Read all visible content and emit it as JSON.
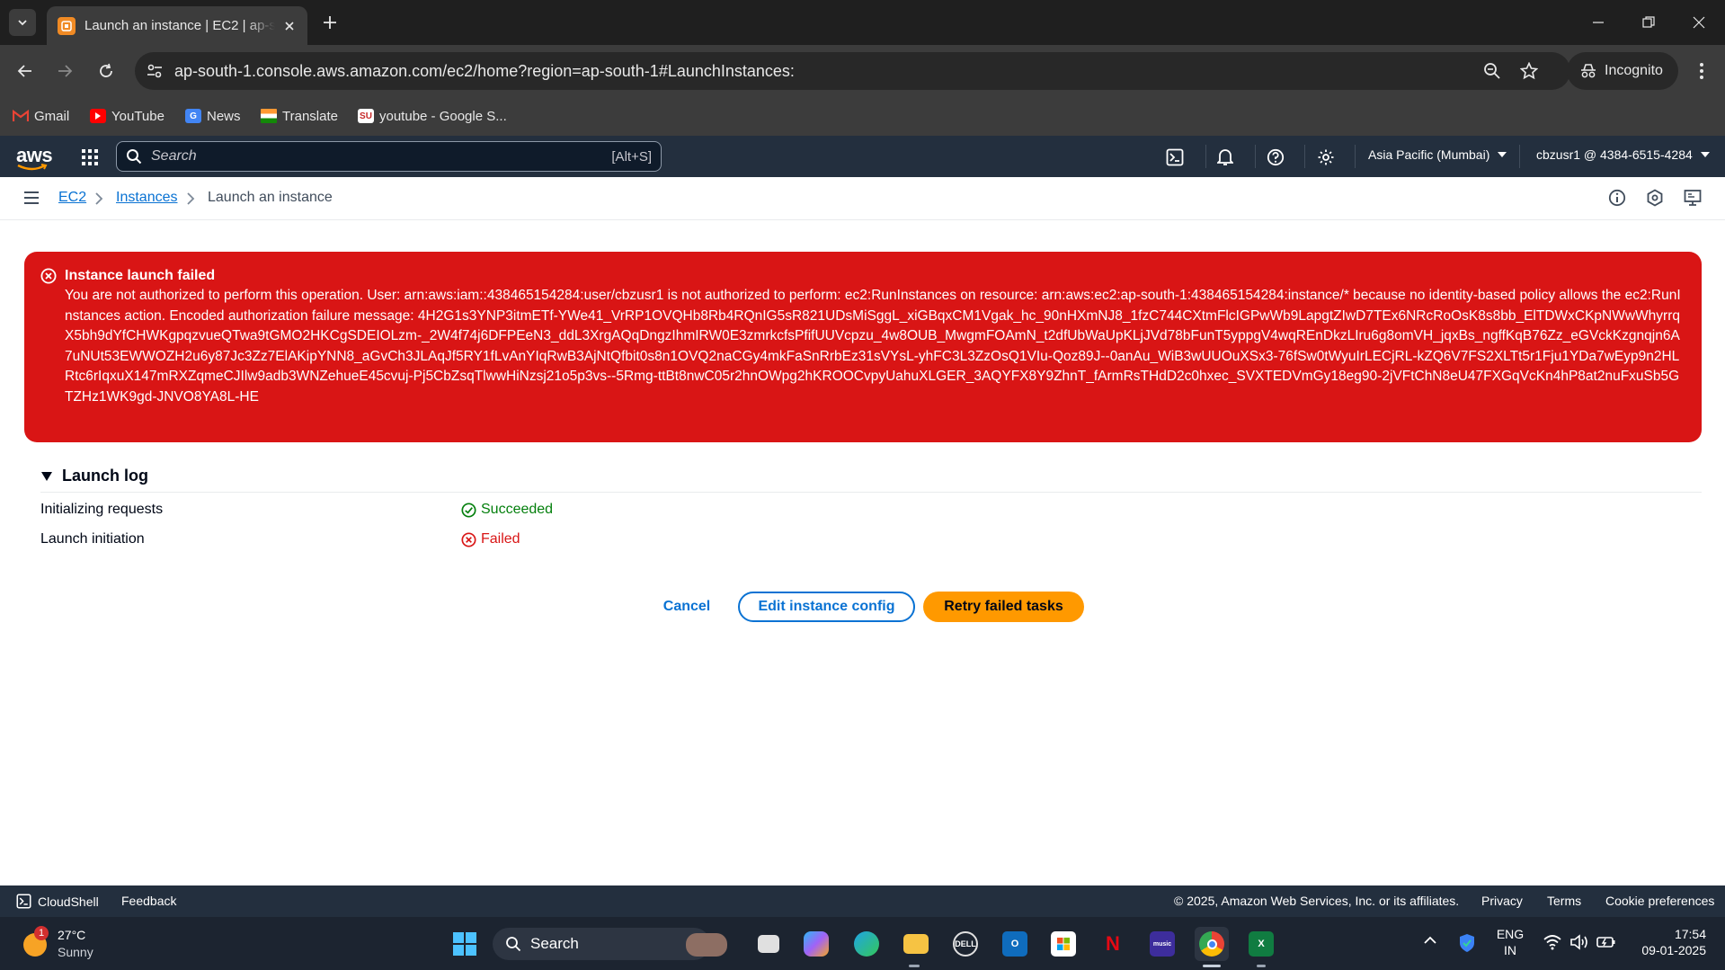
{
  "browser": {
    "tab_title": "Launch an instance | EC2 | ap-south-1",
    "url": "ap-south-1.console.aws.amazon.com/ec2/home?region=ap-south-1#LaunchInstances:",
    "incognito_label": "Incognito",
    "bookmarks": [
      {
        "label": "Gmail",
        "color": "#ea4335",
        "icon": "gmail-icon"
      },
      {
        "label": "YouTube",
        "color": "#ff0000",
        "icon": "youtube-icon"
      },
      {
        "label": "News",
        "color": "#4285f4",
        "icon": "news-icon"
      },
      {
        "label": "Translate",
        "color": "#ff9933",
        "icon": "translate-icon"
      },
      {
        "label": "youtube - Google S...",
        "color": "#6a1b9a",
        "icon": "sheets-icon"
      }
    ]
  },
  "aws_nav": {
    "logo": "aws",
    "search_placeholder": "Search",
    "search_shortcut": "[Alt+S]",
    "region": "Asia Pacific (Mumbai)",
    "account": "cbzusr1 @ 4384-6515-4284"
  },
  "breadcrumb": {
    "items": [
      "EC2",
      "Instances",
      "Launch an instance"
    ]
  },
  "flash": {
    "title": "Instance launch failed",
    "message": "You are not authorized to perform this operation. User: arn:aws:iam::438465154284:user/cbzusr1 is not authorized to perform: ec2:RunInstances on resource: arn:aws:ec2:ap-south-1:438465154284:instance/* because no identity-based policy allows the ec2:RunInstances action. Encoded authorization failure message: 4H2G1s3YNP3itmETf-YWe41_VrRP1OVQHb8Rb4RQnIG5sR821UDsMiSggL_xiGBqxCM1Vgak_hc_90nHXmNJ8_1fzC744CXtmFlcIGPwWb9LapgtZIwD7TEx6NRcRoOsK8s8bb_ElTDWxCKpNWwWhyrrqX5bh9dYfCHWKgpqzvueQTwa9tGMO2HKCgSDEIOLzm-_2W4f74j6DFPEeN3_ddL3XrgAQqDngzIhmIRW0E3zmrkcfsPfifUUVcpzu_4w8OUB_MwgmFOAmN_t2dfUbWaUpKLjJVd78bFunT5yppgV4wqREnDkzLIru6g8omVH_jqxBs_ngffKqB76Zz_eGVckKzgnqjn6A7uNUt53EWWOZH2u6y87Jc3Zz7ElAKipYNN8_aGvCh3JLAqJf5RY1fLvAnYIqRwB3AjNtQfbit0s8n1OVQ2naCGy4mkFaSnRrbEz31sVYsL-yhFC3L3ZzOsQ1VIu-Qoz89J--0anAu_WiB3wUUOuXSx3-76fSw0tWyuIrLECjRL-kZQ6V7FS2XLTt5r1Fju1YDa7wEyp9n2HLRtc6rIqxuX147mRXZqmeCJIlw9adb3WNZehueE45cvuj-Pj5CbZsqTlwwHiNzsj21o5p3vs--5Rmg-ttBt8nwC05r2hnOWpg2hKROOCvpyUahuXLGER_3AQYFX8Y9ZhnT_fArmRsTHdD2c0hxec_SVXTEDVmGy18eg90-2jVFtChN8eU47FXGqVcKn4hP8at2nuFxuSb5GTZHz1WK9gd-JNVO8YA8L-HE"
  },
  "launch_log": {
    "title": "Launch log",
    "rows": [
      {
        "label": "Initializing requests",
        "status": "Succeeded",
        "color": "#037f0c"
      },
      {
        "label": "Launch initiation",
        "status": "Failed",
        "color": "#d91515"
      }
    ]
  },
  "actions": {
    "cancel": "Cancel",
    "edit": "Edit instance config",
    "retry": "Retry failed tasks"
  },
  "footer": {
    "cloudshell": "CloudShell",
    "feedback": "Feedback",
    "copyright": "© 2025, Amazon Web Services, Inc. or its affiliates.",
    "links": [
      "Privacy",
      "Terms",
      "Cookie preferences"
    ]
  },
  "taskbar": {
    "weather_temp": "27°C",
    "weather_desc": "Sunny",
    "weather_badge": "1",
    "search_label": "Search",
    "lang_top": "ENG",
    "lang_bottom": "IN",
    "time": "17:54",
    "date": "09-01-2025"
  },
  "colors": {
    "aws_nav_bg": "#232f3e",
    "error_red": "#d91515",
    "link_blue": "#0972d3",
    "primary_orange": "#ff9900"
  }
}
